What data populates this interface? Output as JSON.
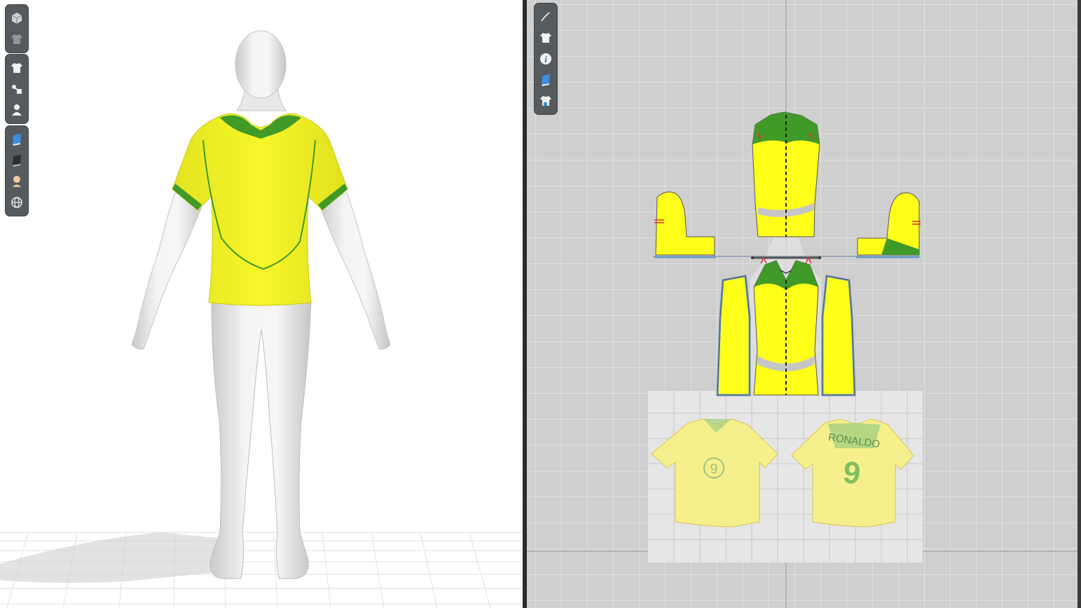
{
  "app": {
    "left_panel": "3d-avatar-window",
    "right_panel": "2d-pattern-window"
  },
  "toolbar3d": {
    "groups": [
      {
        "buttons": [
          "cube-view-icon",
          "garment-display-icon"
        ]
      },
      {
        "buttons": [
          "shirt-icon",
          "avatar-tools-icon",
          "avatar-icon"
        ]
      },
      {
        "buttons": [
          "texture-icon",
          "render-icon",
          "skin-icon",
          "globe-icon"
        ]
      }
    ]
  },
  "toolbar2d": {
    "buttons": [
      "pen-icon",
      "shirt-icon",
      "info-icon",
      "texture-icon",
      "garment-lock-icon"
    ]
  },
  "reference_image": {
    "back_name": "RONALDO",
    "front_number": "9",
    "back_number": "9"
  },
  "colors": {
    "shirt_yellow": "#f3f221",
    "pattern_yellow": "#ffff1a",
    "trim_green": "#3f9a28",
    "outline_blue": "#6a9ac8",
    "canvas_gray": "#cfcfcf",
    "toolbar_bg": "#555a5f"
  }
}
